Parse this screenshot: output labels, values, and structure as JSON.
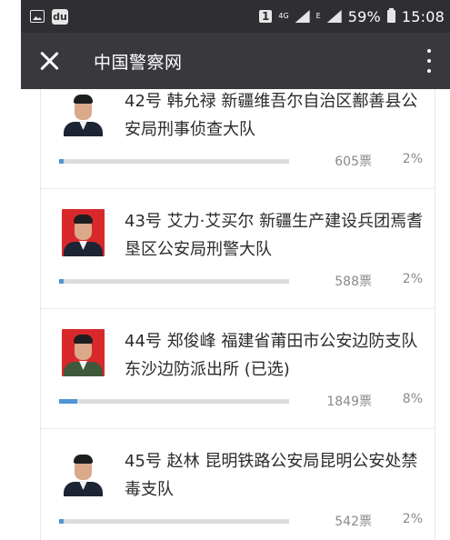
{
  "status_bar": {
    "sim": "1",
    "network": "4G",
    "data_indicator": "E",
    "battery": "59%",
    "time": "15:08"
  },
  "app_bar": {
    "title": "中国警察网"
  },
  "colors": {
    "accent_bar": "#4f95d6",
    "app_bar_bg": "#39393d",
    "status_bar_bg": "#2f2f33"
  },
  "candidates": [
    {
      "text": "42号 韩允禄 新疆维吾尔自治区鄯善县公安局刑事侦查大队",
      "votes": "605票",
      "percent": "2%",
      "share": 0.02,
      "photo_bg": "#ffffff",
      "uniform": "#1d2433"
    },
    {
      "text": "43号 艾力·艾买尔 新疆生产建设兵团焉耆垦区公安局刑警大队",
      "votes": "588票",
      "percent": "2%",
      "share": 0.02,
      "photo_bg": "#d8282b",
      "uniform": "#1d2433"
    },
    {
      "text": "44号 郑俊峰 福建省莆田市公安边防支队东沙边防派出所 (已选)",
      "votes": "1849票",
      "percent": "8%",
      "share": 0.08,
      "photo_bg": "#d8282b",
      "uniform": "#3f5a3a"
    },
    {
      "text": "45号 赵林 昆明铁路公安局昆明公安处禁毒支队",
      "votes": "542票",
      "percent": "2%",
      "share": 0.02,
      "photo_bg": "#ffffff",
      "uniform": "#1d2433"
    }
  ]
}
